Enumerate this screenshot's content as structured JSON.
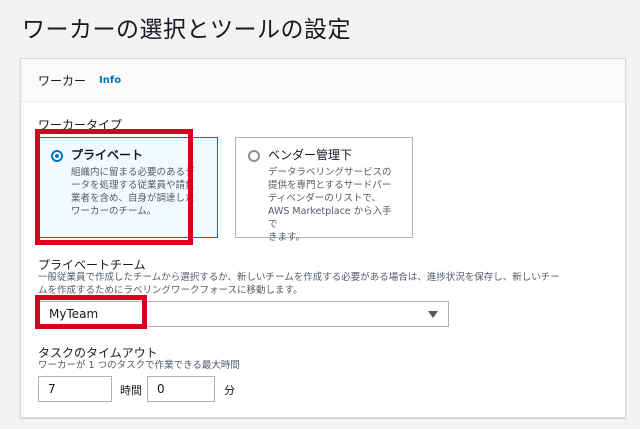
{
  "page": {
    "title": "ワーカーの選択とツールの設定"
  },
  "panel": {
    "header_title": "ワーカー",
    "info_link": "Info"
  },
  "worker_type": {
    "label": "ワーカータイプ",
    "options": [
      {
        "title": "プライベート",
        "lines": [
          "組織内に留まる必要のあるデ",
          "ータを処理する従業員や請負",
          "業者を含め、自身が調達した",
          "ワーカーのチーム。"
        ],
        "selected": true
      },
      {
        "title": "ベンダー管理下",
        "lines": [
          "データラベリングサービスの",
          "提供を専門とするサードパー",
          "ティベンダーのリストで、",
          "AWS Marketplace から入手で",
          "きます。"
        ],
        "selected": false
      }
    ]
  },
  "private_team": {
    "label": "プライベートチーム",
    "desc_lines": [
      "一般従業員で作成したチームから選択するか、新しいチームを作成する必要がある場合は、進捗状況を保存し、新しいチー",
      "ムを作成するためにラベリングワークフォースに移動します。"
    ],
    "selected_value": "MyTeam"
  },
  "task_timeout": {
    "label": "タスクのタイムアウト",
    "desc": "ワーカーが 1 つのタスクで作業できる最大時間",
    "hours_value": "7",
    "hours_unit": "時間",
    "minutes_value": "0",
    "minutes_unit": "分"
  },
  "colors": {
    "accent": "#0073bb",
    "highlight": "#d6001c",
    "background": "#f2f3f3"
  },
  "icons": {
    "radio_selected": "radio-selected-icon",
    "radio_unselected": "radio-unselected-icon",
    "dropdown": "caret-down-icon"
  }
}
